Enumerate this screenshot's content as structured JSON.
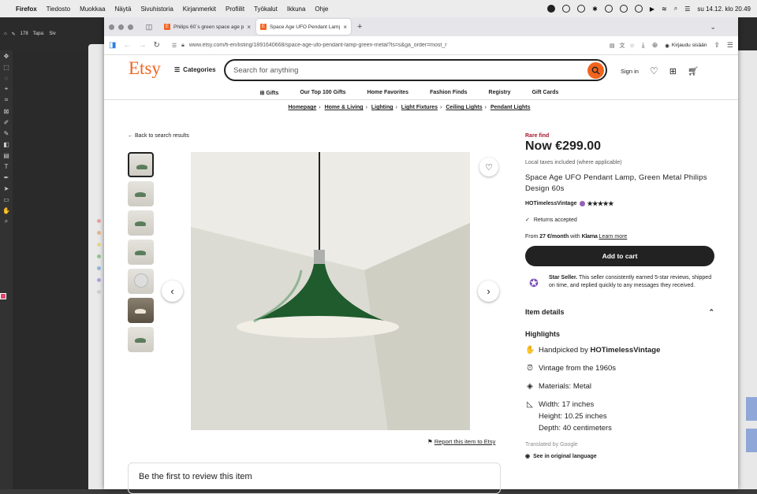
{
  "mac_menu": {
    "app": "Firefox",
    "items": [
      "Tiedosto",
      "Muokkaa",
      "Näytä",
      "Sivuhistoria",
      "Kirjanmerkit",
      "Profiilit",
      "Työkalut",
      "Ikkuna",
      "Ohje"
    ],
    "clock": "su 14.12. klo 20.49"
  },
  "ps": {
    "opt_size": "178",
    "opt_label": "Tapa:",
    "opt_label2": "Siv"
  },
  "tabs": [
    {
      "title": "Philips 60´s green space age p",
      "favicon": "E"
    },
    {
      "title": "Space Age UFO Pendant Lamp,",
      "favicon": "E"
    }
  ],
  "url": "www.etsy.com/fi-en/listing/1891640668/space-age-ufo-pendant-lamp-green-metal?ls=s&ga_order=most_r",
  "ff_signin": "Kirjaudu sisään",
  "etsy": {
    "logo": "Etsy",
    "categories": "Categories",
    "search_placeholder": "Search for anything",
    "sign_in": "Sign in",
    "subnav": [
      "Gifts",
      "Our Top 100 Gifts",
      "Home Favorites",
      "Fashion Finds",
      "Registry",
      "Gift Cards"
    ],
    "breadcrumb": [
      "Homepage",
      "Home & Living",
      "Lighting",
      "Light Fixtures",
      "Ceiling Lights",
      "Pendant Lights"
    ],
    "back": "Back to search results",
    "report_pre": "",
    "report": "Report this item to Etsy",
    "review": "Be the first to review this item"
  },
  "product": {
    "badge": "Rare find",
    "price": "Now €299.00",
    "tax": "Local taxes included (where applicable)",
    "title": "Space Age UFO Pendant Lamp, Green Metal Philips Design 60s",
    "shop": "HOTimelessVintage",
    "stars": "★★★★★",
    "returns": "Returns accepted",
    "klarna_pre": "From ",
    "klarna_amount": "27 €/month",
    "klarna_with": " with ",
    "klarna_brand": "Klarna",
    "klarna_link": "Learn more",
    "add_to_cart": "Add to cart",
    "star_seller_title": "Star Seller.",
    "star_seller_text": " This seller consistently earned 5-star reviews, shipped on time, and replied quickly to any messages they received.",
    "item_details": "Item details",
    "highlights": "Highlights",
    "handpicked_pre": "Handpicked by ",
    "handpicked_shop": "HOTimelessVintage",
    "vintage": "Vintage from the 1960s",
    "materials": "Materials: Metal",
    "width": "Width: 17 inches",
    "height": "Height: 10.25 inches",
    "depth": "Depth: 40 centimeters",
    "translated": "Translated by Google",
    "original": "See in original language"
  },
  "colors": {
    "etsy_orange": "#f1641e",
    "rare_red": "#a61a2e",
    "lamp_green": "#1f5b2c"
  }
}
